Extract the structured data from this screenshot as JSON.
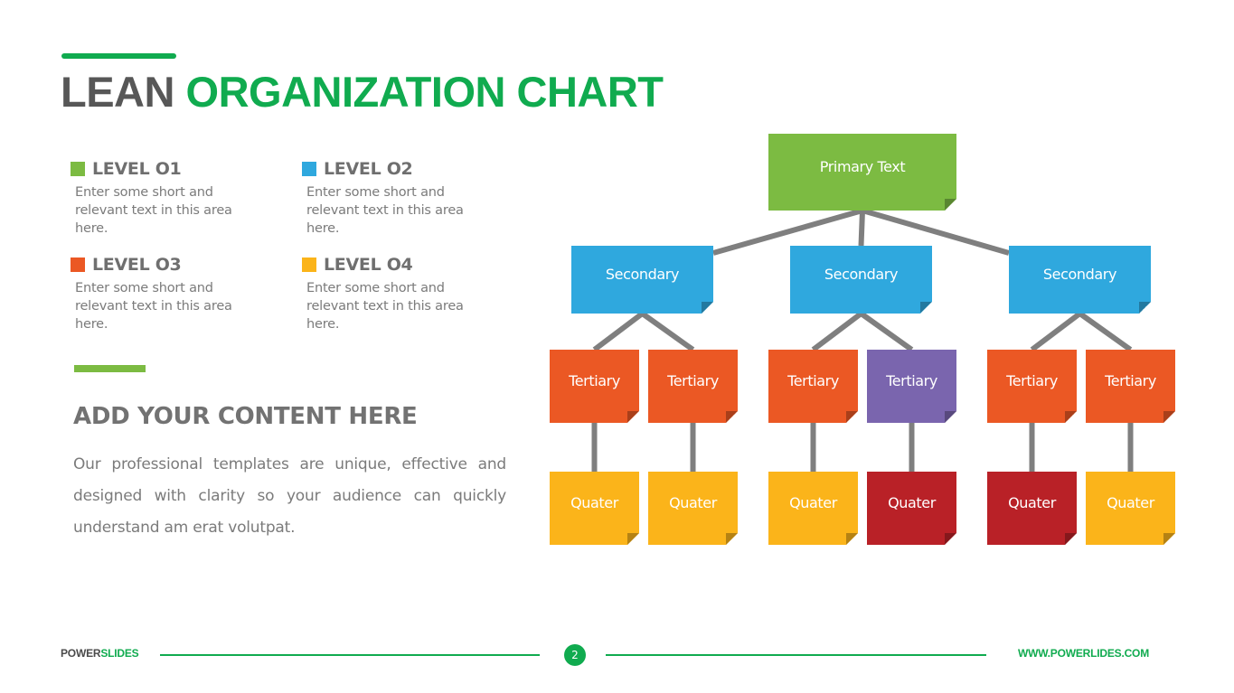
{
  "header": {
    "title_part1": "LEAN",
    "title_part2": "ORGANIZATION CHART"
  },
  "colors": {
    "brand_green": "#10ab4f",
    "level1": "#7cbb42",
    "level2": "#2fa8de",
    "level3": "#eb5824",
    "level4": "#fbb41a",
    "accent_purple": "#7a65ae",
    "accent_red": "#b92127",
    "connector": "#7f7f7f"
  },
  "legend": [
    {
      "label": "LEVEL O1",
      "description": "Enter some short and relevant text in this area here.",
      "color": "#7cbb42"
    },
    {
      "label": "LEVEL O2",
      "description": "Enter some short and relevant text in this area here.",
      "color": "#2fa8de"
    },
    {
      "label": "LEVEL O3",
      "description": "Enter some short and relevant text in this area here.",
      "color": "#eb5824"
    },
    {
      "label": "LEVEL O4",
      "description": "Enter some short and relevant text in this area here.",
      "color": "#fbb41a"
    }
  ],
  "content": {
    "title": "ADD YOUR CONTENT HERE",
    "body": "Our professional templates are unique, effective and designed with clarity so your audience can quickly understand am erat volutpat."
  },
  "org_chart": {
    "primary": {
      "label": "Primary Text",
      "color": "#7cbb42"
    },
    "secondary": [
      {
        "label": "Secondary",
        "color": "#2fa8de",
        "children": [
          {
            "label": "Tertiary",
            "color": "#eb5824",
            "child": {
              "label": "Quater",
              "color": "#fbb41a"
            }
          },
          {
            "label": "Tertiary",
            "color": "#eb5824",
            "child": {
              "label": "Quater",
              "color": "#fbb41a"
            }
          }
        ]
      },
      {
        "label": "Secondary",
        "color": "#2fa8de",
        "children": [
          {
            "label": "Tertiary",
            "color": "#eb5824",
            "child": {
              "label": "Quater",
              "color": "#fbb41a"
            }
          },
          {
            "label": "Tertiary",
            "color": "#7a65ae",
            "child": {
              "label": "Quater",
              "color": "#b92127"
            }
          }
        ]
      },
      {
        "label": "Secondary",
        "color": "#2fa8de",
        "children": [
          {
            "label": "Tertiary",
            "color": "#eb5824",
            "child": {
              "label": "Quater",
              "color": "#b92127"
            }
          },
          {
            "label": "Tertiary",
            "color": "#eb5824",
            "child": {
              "label": "Quater",
              "color": "#fbb41a"
            }
          }
        ]
      }
    ]
  },
  "footer": {
    "brand_part1": "POWER",
    "brand_part2": "SLIDES",
    "page_number": "2",
    "url": "WWW.POWERLIDES.COM"
  }
}
